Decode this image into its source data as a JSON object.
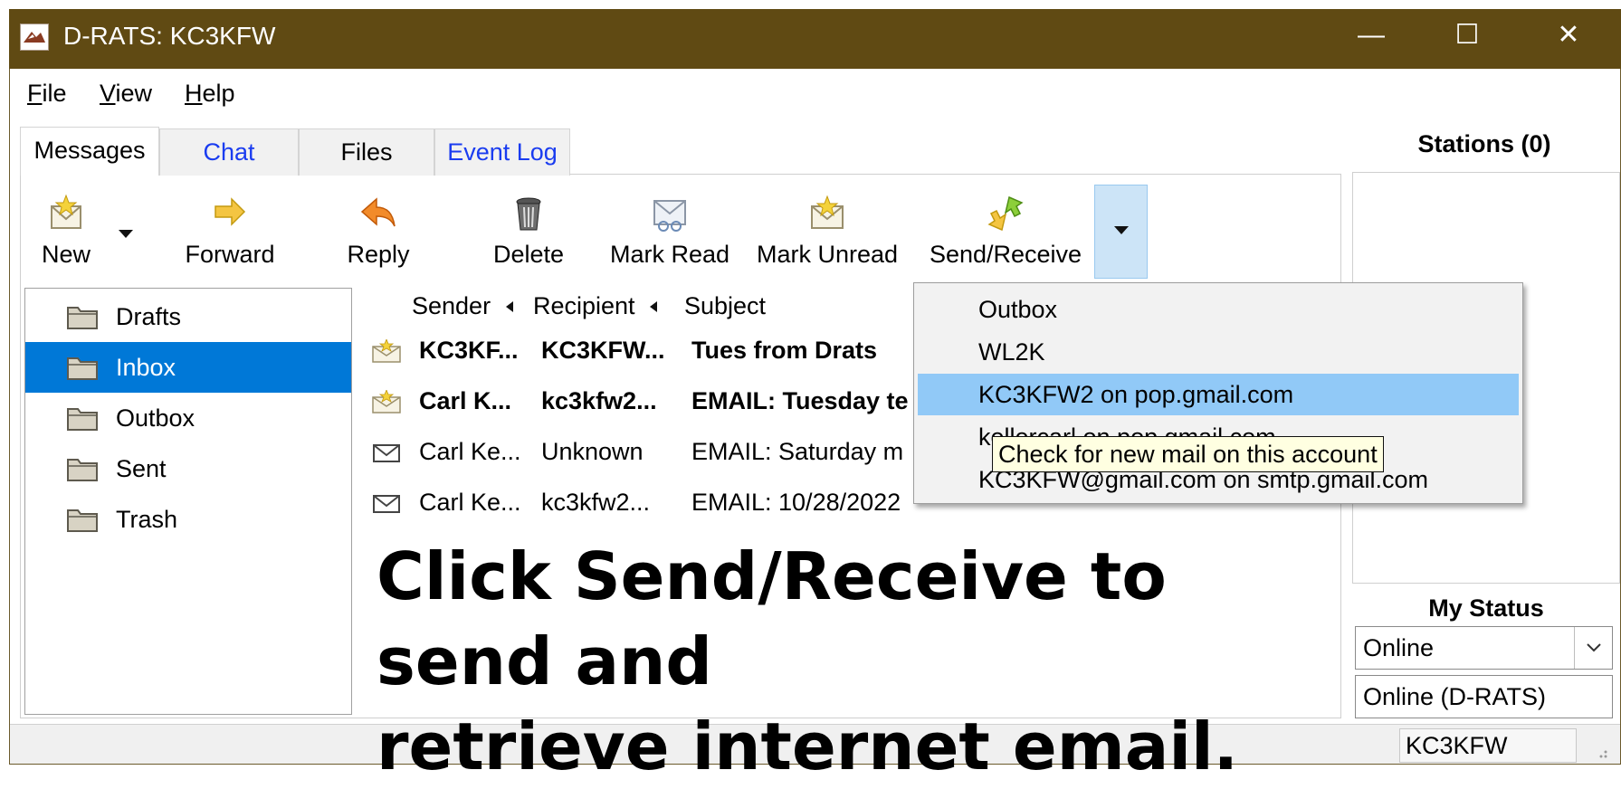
{
  "window": {
    "title": "D-RATS: KC3KFW",
    "controls": {
      "minimize": "—",
      "maximize": "☐",
      "close": "✕"
    }
  },
  "menu": [
    "File",
    "View",
    "Help"
  ],
  "tabs": [
    {
      "label": "Messages",
      "active": true
    },
    {
      "label": "Chat",
      "active": false
    },
    {
      "label": "Files",
      "active": false
    },
    {
      "label": "Event Log",
      "active": false
    }
  ],
  "toolbar": {
    "new": "New",
    "forward": "Forward",
    "reply": "Reply",
    "delete": "Delete",
    "mark_read": "Mark Read",
    "mark_unread": "Mark Unread",
    "send_receive": "Send/Receive"
  },
  "folders": [
    {
      "label": "Drafts",
      "selected": false
    },
    {
      "label": "Inbox",
      "selected": true
    },
    {
      "label": "Outbox",
      "selected": false
    },
    {
      "label": "Sent",
      "selected": false
    },
    {
      "label": "Trash",
      "selected": false
    }
  ],
  "message_list": {
    "columns": {
      "sender": "Sender",
      "recipient": "Recipient",
      "subject": "Subject"
    },
    "rows": [
      {
        "sender": "KC3KF...",
        "recipient": "KC3KFW...",
        "subject": "Tues from Drats",
        "unread": true
      },
      {
        "sender": "Carl K...",
        "recipient": "kc3kfw2...",
        "subject": "EMAIL: Tuesday te",
        "unread": true
      },
      {
        "sender": "Carl Ke...",
        "recipient": "Unknown",
        "subject": "EMAIL: Saturday m",
        "unread": false
      },
      {
        "sender": "Carl Ke...",
        "recipient": "kc3kfw2...",
        "subject": "EMAIL: 10/28/2022",
        "unread": false
      }
    ]
  },
  "stations": {
    "title": "Stations (0)"
  },
  "my_status": {
    "title": "My Status",
    "selected": "Online",
    "message": "Online (D-RATS)"
  },
  "status_bar": {
    "callsign": "KC3KFW"
  },
  "send_receive_menu": {
    "items": [
      {
        "label": "Outbox",
        "highlighted": false
      },
      {
        "label": "WL2K",
        "highlighted": false
      },
      {
        "label": "KC3KFW2 on pop.gmail.com",
        "highlighted": true
      },
      {
        "label": "kellercarl on pop.gmail.com",
        "highlighted": false
      },
      {
        "label": "KC3KFW@gmail.com on smtp.gmail.com",
        "highlighted": false
      }
    ]
  },
  "tooltip": "Check for new mail on this account",
  "annotation": {
    "line1": "Click Send/Receive to send and",
    "line2": "retrieve internet email."
  },
  "colors": {
    "titlebar": "#604a13",
    "selection": "#0078d7",
    "menu_highlight": "#91c9f7",
    "link_tab": "#1a3cf0",
    "tooltip_bg": "#ffffe1"
  }
}
